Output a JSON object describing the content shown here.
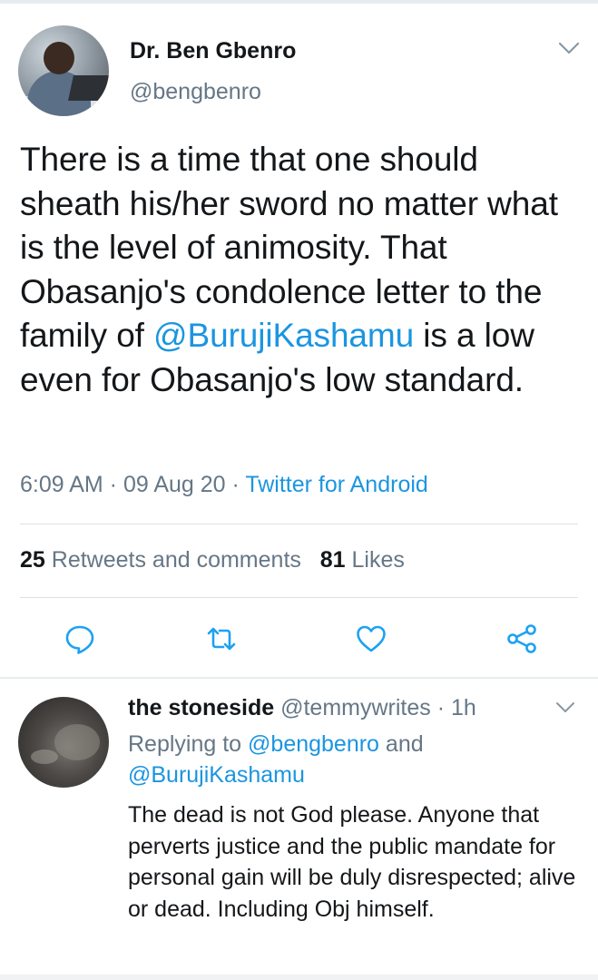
{
  "tweet": {
    "display_name": "Dr. Ben Gbenro",
    "handle": "@bengbenro",
    "text_before_mention": "There is a time that one should sheath his/her sword no matter what is the level of animosity. That Obasanjo's condolence letter to the family of ",
    "mention": "@BurujiKashamu",
    "text_after_mention": " is a low even for Obasanjo's low standard.",
    "time": "6:09 AM · 09 Aug 20 · ",
    "client": "Twitter for Android",
    "retweets_count": "25",
    "retweets_label": "Retweets and comments",
    "likes_count": "81",
    "likes_label": "Likes"
  },
  "actions": [
    {
      "icon": "reply-icon"
    },
    {
      "icon": "retweet-icon"
    },
    {
      "icon": "like-heart-icon"
    },
    {
      "icon": "share-icon"
    }
  ],
  "reply": {
    "display_name": "the stoneside",
    "handle_time": " @temmywrites · 1h",
    "replying_prefix": "Replying to ",
    "replying_to_1": "@bengbenro",
    "replying_and": " and",
    "replying_to_2": "@BurujiKashamu",
    "text": "The dead is not God please. Anyone that perverts justice and the public mandate for personal gain will be duly disrespected; alive or dead. Including Obj himself."
  },
  "colors": {
    "accent": "#1b95e0",
    "secondary_text": "#657786",
    "primary_text": "#14171a",
    "divider": "#e6ecf0"
  }
}
